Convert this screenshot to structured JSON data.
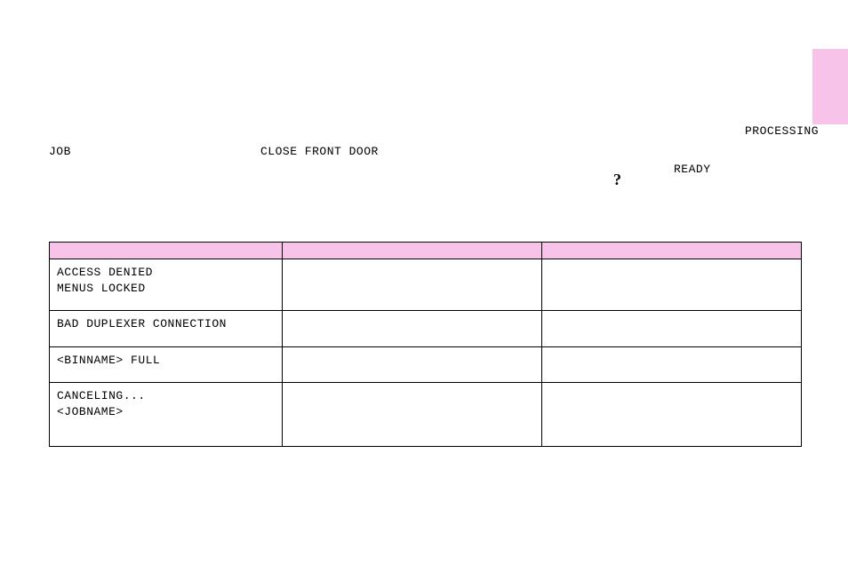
{
  "side_tab_color": "#f7c3e9",
  "loose_text": {
    "processing": "PROCESSING",
    "job": "JOB",
    "close_front_door": "CLOSE FRONT DOOR",
    "ready": "READY",
    "question_mark": "?"
  },
  "table": {
    "headers": [
      "",
      "",
      ""
    ],
    "rows": [
      {
        "c1_line1": "ACCESS DENIED",
        "c1_line2": "MENUS LOCKED",
        "c2": "",
        "c3": ""
      },
      {
        "c1_line1": "BAD DUPLEXER CONNECTION",
        "c1_line2": "",
        "c2": "",
        "c3": ""
      },
      {
        "c1_line1": "<BINNAME> FULL",
        "c1_line2": "",
        "c2": "",
        "c3": ""
      },
      {
        "c1_line1": "CANCELING...",
        "c1_line2": "<JOBNAME>",
        "c2": "",
        "c3": ""
      }
    ]
  }
}
